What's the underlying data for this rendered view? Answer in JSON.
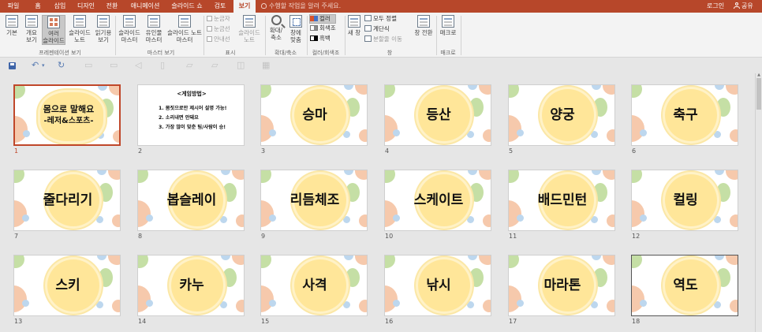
{
  "tabs": [
    {
      "label": "파일",
      "active": false
    },
    {
      "label": "홈",
      "active": false
    },
    {
      "label": "삽입",
      "active": false
    },
    {
      "label": "디자인",
      "active": false
    },
    {
      "label": "전환",
      "active": false
    },
    {
      "label": "애니메이션",
      "active": false
    },
    {
      "label": "슬라이드 쇼",
      "active": false
    },
    {
      "label": "검토",
      "active": false
    },
    {
      "label": "보기",
      "active": true
    }
  ],
  "tell_me": "수행할 작업을 알려 주세요.",
  "account": {
    "login": "로그인",
    "share": "공유"
  },
  "ribbon": {
    "normal": "기본",
    "outline": [
      "개요",
      "보기"
    ],
    "sorter": [
      "여러",
      "슬라이드"
    ],
    "notes": [
      "슬라이드",
      "노트"
    ],
    "reading": [
      "읽기용",
      "보기"
    ],
    "group_presentation_views": "프레젠테이션 보기",
    "slide_master": [
      "슬라이드",
      "마스터"
    ],
    "handout_master": [
      "유인물",
      "마스터"
    ],
    "notes_master": [
      "슬라이드 노트",
      "마스터"
    ],
    "group_master_views": "마스터 보기",
    "ruler": "눈금자",
    "gridlines": "눈금선",
    "guides": "안내선",
    "notes_btn": [
      "슬라이드",
      "노트"
    ],
    "group_show": "표시",
    "zoom": [
      "확대/",
      "축소"
    ],
    "fit": [
      "창에",
      "맞춤"
    ],
    "group_zoom": "확대/축소",
    "color": "컬러",
    "grayscale": "회색조",
    "bw": "흑백",
    "group_color": "컬러/회색조",
    "new_window": [
      "새 창"
    ],
    "arrange_all": "모두 정렬",
    "cascade": "계단식",
    "move_split": "분할줄 이동",
    "group_window": "창",
    "switch_window": [
      "창 전환"
    ],
    "macros": "매크로",
    "group_macros": "매크로"
  },
  "slides": [
    {
      "num": "1",
      "type": "title2",
      "line1": "몸으로 말해요",
      "line2": "-레저&스포츠-"
    },
    {
      "num": "2",
      "type": "instructions",
      "head": "<게임방법>",
      "lines": [
        "1. 몸짓으로만 제시어 설명 가능!",
        "2. 소리내면 안돼요",
        "3. 가장 많이 맞춘 팀/사람이 승!"
      ]
    },
    {
      "num": "3",
      "type": "word",
      "word": "승마"
    },
    {
      "num": "4",
      "type": "word",
      "word": "등산"
    },
    {
      "num": "5",
      "type": "word",
      "word": "양궁"
    },
    {
      "num": "6",
      "type": "word",
      "word": "축구"
    },
    {
      "num": "7",
      "type": "word",
      "word": "줄다리기"
    },
    {
      "num": "8",
      "type": "word",
      "word": "봅슬레이"
    },
    {
      "num": "9",
      "type": "word",
      "word": "리듬체조"
    },
    {
      "num": "10",
      "type": "word",
      "word": "스케이트"
    },
    {
      "num": "11",
      "type": "word",
      "word": "배드민턴"
    },
    {
      "num": "12",
      "type": "word",
      "word": "컬링"
    },
    {
      "num": "13",
      "type": "word",
      "word": "스키"
    },
    {
      "num": "14",
      "type": "word",
      "word": "카누"
    },
    {
      "num": "15",
      "type": "word",
      "word": "사격"
    },
    {
      "num": "16",
      "type": "word",
      "word": "낚시"
    },
    {
      "num": "17",
      "type": "word",
      "word": "마라톤"
    },
    {
      "num": "18",
      "type": "word",
      "word": "역도"
    }
  ],
  "colors": {
    "accent": "#b7472a",
    "sun": "#ffe699",
    "green": "#c5dfa5",
    "peach": "#f6c9ac",
    "blue": "#bdd7ee"
  }
}
